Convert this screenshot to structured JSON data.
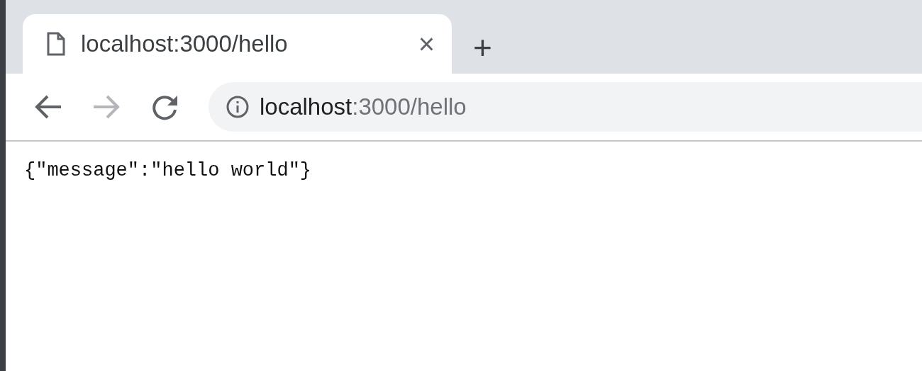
{
  "tabs": [
    {
      "title": "localhost:3000/hello",
      "close": "×",
      "selected": true
    }
  ],
  "new_tab": "+",
  "nav_buttons": [
    {
      "kind": "back",
      "disabled": false
    },
    {
      "kind": "forward",
      "disabled": true
    },
    {
      "kind": "reload",
      "disabled": false
    }
  ],
  "address_bar": {
    "host": "localhost",
    "rest": ":3000/hello"
  },
  "content": {
    "text": "{\"message\":\"hello world\"}"
  }
}
